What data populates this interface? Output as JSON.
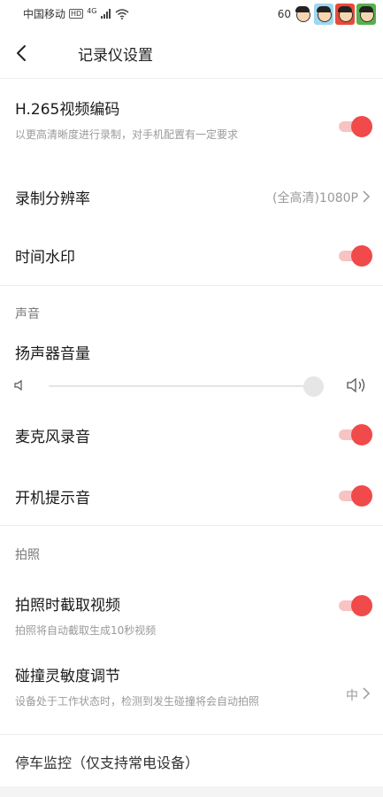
{
  "status_bar": {
    "carrier": "中国移动",
    "hd": "HD",
    "network": "4G",
    "battery": "60"
  },
  "header": {
    "title": "记录仪设置"
  },
  "settings": {
    "h265": {
      "title": "H.265视频编码",
      "description": "以更高清晰度进行录制，对手机配置有一定要求",
      "enabled": true
    },
    "resolution": {
      "title": "录制分辨率",
      "value": "(全高清)1080P"
    },
    "watermark": {
      "title": "时间水印",
      "enabled": true
    },
    "sound_section": "声音",
    "speaker_volume": {
      "title": "扬声器音量",
      "level": 1.0
    },
    "mic_record": {
      "title": "麦克风录音",
      "enabled": true
    },
    "boot_sound": {
      "title": "开机提示音",
      "enabled": true
    },
    "photo_section": "拍照",
    "photo_video": {
      "title": "拍照时截取视频",
      "description": "拍照将自动截取生成10秒视频",
      "enabled": true
    },
    "collision": {
      "title": "碰撞灵敏度调节",
      "description": "设备处于工作状态时，检测到发生碰撞将会自动拍照",
      "value": "中"
    },
    "parking": {
      "title": "停车监控（仅支持常电设备）"
    }
  },
  "colors": {
    "accent": "#f04a4a",
    "accent_track": "#f7c3c3"
  }
}
